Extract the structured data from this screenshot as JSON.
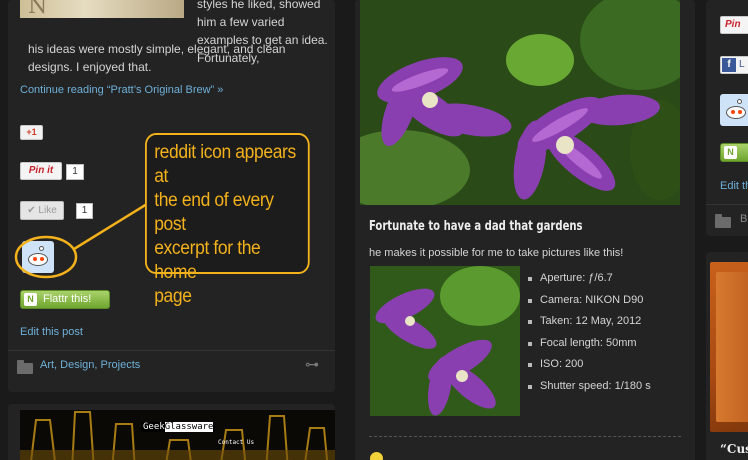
{
  "left_post": {
    "excerpt_right": "styles he liked, showed him a few varied examples to get an idea. Fortunately,",
    "excerpt_full": "his ideas were mostly simple, elegant, and clean designs. I enjoyed that.",
    "continue_link": "Continue reading “Pratt’s Original Brew” »",
    "gplus_label": "+1",
    "pinterest_label": "Pin it",
    "pinterest_count": "1",
    "like_label": "Like",
    "like_count": "1",
    "flattr_label": "Flattr this!",
    "edit_link": "Edit this post",
    "categories": "Art, Design, Projects",
    "thumb_glyph": "N"
  },
  "annotation": {
    "lines": [
      "reddit icon appears at",
      "the end of every post",
      "excerpt for the home",
      "page"
    ],
    "color": "#f3b11c"
  },
  "next_post": {
    "banner_title_a": "Geek",
    "banner_title_b": "Glassware",
    "banner_contact": "Contact Us"
  },
  "center_post": {
    "title": "Fortunate to have a dad that gardens",
    "subtitle": "he makes it possible for me to take pictures like this!",
    "exif": [
      "Aperture: ƒ/6.7",
      "Camera: NIKON D90",
      "Taken: 12 May, 2012",
      "Focal length: 50mm",
      "ISO: 200",
      "Shutter speed: 1/180 s"
    ]
  },
  "right_column": {
    "pinterest_label": "Pin",
    "facebook_label": "L",
    "edit_link": "Edit th",
    "category_letter": "B",
    "quote_text": "“Cust"
  },
  "colors": {
    "link": "#6fb0d8",
    "accent": "#f3b11c",
    "background": "#1a1a1a",
    "card": "#232323"
  }
}
